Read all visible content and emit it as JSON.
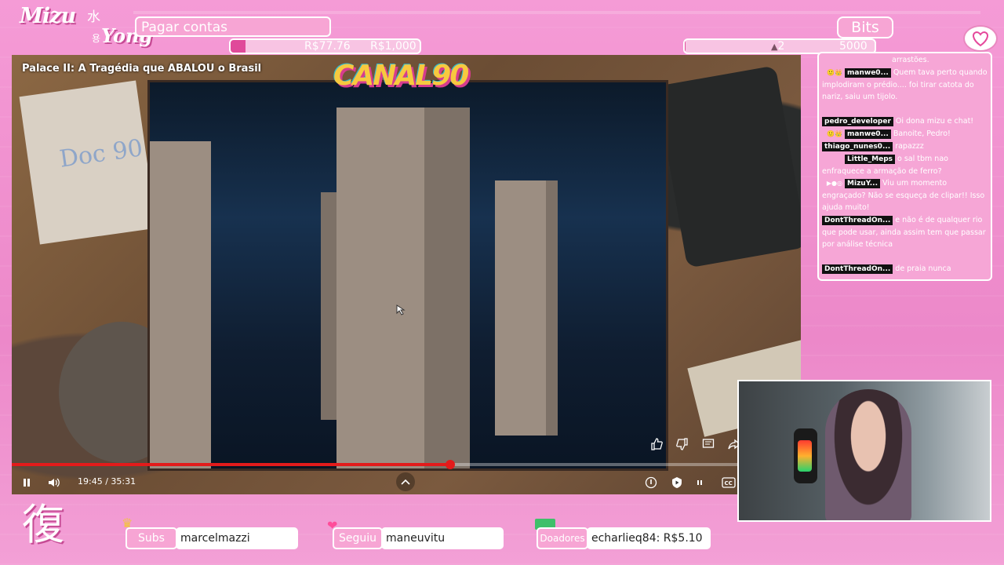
{
  "logo": {
    "main": "Mizu",
    "kanji": "水",
    "hangul": "용",
    "yong": "Yong"
  },
  "goal": {
    "title": "Pagar contas",
    "current": "R$77.76",
    "max": "R$1,000",
    "progress": 0.078
  },
  "bits": {
    "label": "Bits",
    "current": "2",
    "max": "5000",
    "progress": 0.0004
  },
  "video": {
    "title": "Palace II: A Tragédia que ABALOU o Brasil",
    "time": "19:45 / 35:31",
    "progress": 0.556,
    "overlay_logo": "CANAL90",
    "paper_note": "Doc 90"
  },
  "chat": [
    {
      "icons": "",
      "name": "",
      "text": "arrastões."
    },
    {
      "icons": "🙂👑",
      "name": "manwe0...",
      "text": "Quem tava perto quando implodiram o prédio.... foi tirar catota do nariz, saiu um tijolo."
    },
    {
      "icons": "",
      "name": "pedro_developer",
      "text": "Oi dona mizu e chat!"
    },
    {
      "icons": "🙂👑",
      "name": "manwe0...",
      "text": "Banoite, Pedro!"
    },
    {
      "icons": "",
      "name": "thiago_nunes0...",
      "text": "rapazzz"
    },
    {
      "icons": "",
      "name": "Little_Meps",
      "text": "o sal tbm nao enfraquece a armação de ferro?"
    },
    {
      "icons": "▶●◎",
      "name": "MizuY...",
      "text": "Viu um momento engraçado? Não se esqueça de clipar!! Isso ajuda muito!"
    },
    {
      "icons": "",
      "name": "DontThreadOn...",
      "text": "e não é de qualquer rio que pode usar, ainda assim tem que passar por análise técnica"
    },
    {
      "icons": "",
      "name": "DontThreadOn...",
      "text": "de praia nunca"
    }
  ],
  "bottom": {
    "logo_char": "復",
    "subs": {
      "label": "Subs",
      "value": "marcelmazzi"
    },
    "follow": {
      "label": "Seguiu",
      "value": "maneuvitu"
    },
    "donors": {
      "label": "Doadores",
      "value": "echarlieq84: R$5.10"
    }
  },
  "colors": {
    "frame": "#ef8fcf",
    "accent": "#e04a9a",
    "progress": "#e31b1b"
  }
}
